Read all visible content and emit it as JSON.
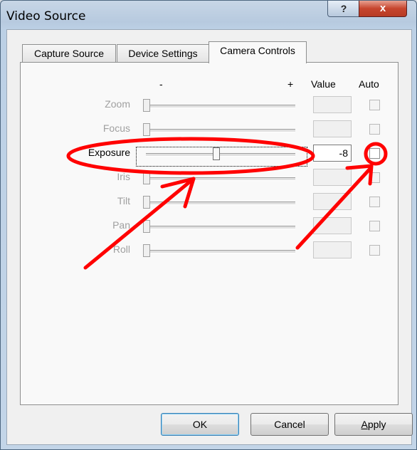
{
  "window": {
    "title": "Video Source",
    "help_label": "?",
    "close_label": "x"
  },
  "tabs": [
    {
      "label": "Capture Source",
      "active": false
    },
    {
      "label": "Device Settings",
      "active": false
    },
    {
      "label": "Camera Controls",
      "active": true
    }
  ],
  "headers": {
    "minus": "-",
    "plus": "+",
    "value": "Value",
    "auto": "Auto"
  },
  "controls": [
    {
      "label": "Zoom",
      "enabled": false,
      "value": "",
      "auto": false,
      "slider_level": 0.0
    },
    {
      "label": "Focus",
      "enabled": false,
      "value": "",
      "auto": false,
      "slider_level": 0.0
    },
    {
      "label": "Exposure",
      "enabled": true,
      "value": "-8",
      "auto": false,
      "slider_level": 0.48
    },
    {
      "label": "Iris",
      "enabled": false,
      "value": "",
      "auto": false,
      "slider_level": 0.0
    },
    {
      "label": "Tilt",
      "enabled": false,
      "value": "",
      "auto": false,
      "slider_level": 0.0
    },
    {
      "label": "Pan",
      "enabled": false,
      "value": "",
      "auto": false,
      "slider_level": 0.0
    },
    {
      "label": "Roll",
      "enabled": false,
      "value": "",
      "auto": false,
      "slider_level": 0.0
    }
  ],
  "buttons": {
    "ok": "OK",
    "cancel": "Cancel",
    "apply": "Apply"
  },
  "annotation_color": "#ff0000"
}
